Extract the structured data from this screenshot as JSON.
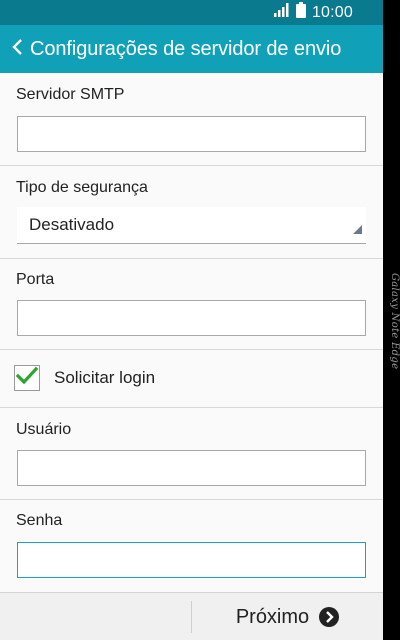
{
  "status_bar": {
    "time": "10:00",
    "icons": [
      "signal-icon",
      "battery-icon"
    ]
  },
  "app_bar": {
    "title": "Configurações de servidor de envio",
    "back_icon": "chevron-left-icon"
  },
  "form": {
    "smtp_server": {
      "label": "Servidor SMTP",
      "value": ""
    },
    "security_type": {
      "label": "Tipo de segurança",
      "selected": "Desativado"
    },
    "port": {
      "label": "Porta",
      "value": ""
    },
    "require_login": {
      "label": "Solicitar login",
      "checked": true
    },
    "username": {
      "label": "Usuário",
      "value": ""
    },
    "password": {
      "label": "Senha",
      "value": ""
    }
  },
  "bottom_bar": {
    "next_label": "Próximo",
    "next_icon": "arrow-right-circle-icon"
  },
  "edge_panel": {
    "label": "Galaxy Note Edge"
  },
  "colors": {
    "status_bar": "#0a7a8f",
    "app_bar": "#10a1b8",
    "check": "#2da62d",
    "focus": "#1aa3bf"
  }
}
